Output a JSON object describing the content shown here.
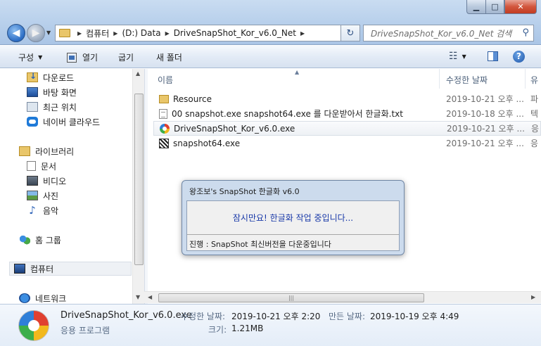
{
  "window": {
    "controls": {
      "minimize": "▁",
      "maximize": "□",
      "close": "✕"
    }
  },
  "address": {
    "segments": [
      "컴퓨터",
      "(D:) Data",
      "DriveSnapShot_Kor_v6.0_Net"
    ],
    "search_placeholder": "DriveSnapShot_Kor_v6.0_Net 검색"
  },
  "toolbar": {
    "organize": "구성",
    "open": "열기",
    "share": "굽기",
    "new_folder": "새 폴더"
  },
  "sidebar": {
    "favorites": [
      {
        "label": "다운로드",
        "icon": "download-folder-icon"
      },
      {
        "label": "바탕 화면",
        "icon": "desktop-icon"
      },
      {
        "label": "최근 위치",
        "icon": "recent-places-icon"
      },
      {
        "label": "네이버 클라우드",
        "icon": "naver-cloud-icon"
      }
    ],
    "libraries": {
      "label": "라이브러리",
      "items": [
        {
          "label": "문서",
          "icon": "documents-icon"
        },
        {
          "label": "비디오",
          "icon": "videos-icon"
        },
        {
          "label": "사진",
          "icon": "pictures-icon"
        },
        {
          "label": "음악",
          "icon": "music-icon"
        }
      ]
    },
    "homegroup": "홈 그룹",
    "computer": "컴퓨터",
    "network": "네트워크"
  },
  "columns": {
    "name": "이름",
    "date_modified": "수정한 날짜",
    "type": "유"
  },
  "files": [
    {
      "name": "Resource",
      "date": "2019-10-21 오후 ...",
      "type": "파",
      "icon": "folder-icon"
    },
    {
      "name": "00 snapshot.exe snapshot64.exe 를 다운받아서 한글화.txt",
      "date": "2019-10-18 오후 ...",
      "type": "텍",
      "icon": "text-file-icon"
    },
    {
      "name": "DriveSnapShot_Kor_v6.0.exe",
      "date": "2019-10-21 오후 ...",
      "type": "응",
      "icon": "app-icon"
    },
    {
      "name": "snapshot64.exe",
      "date": "2019-10-21 오후 ...",
      "type": "응",
      "icon": "exe-icon"
    }
  ],
  "details": {
    "name": "DriveSnapShot_Kor_v6.0.exe",
    "type": "응용 프로그램",
    "modified_label": "수정한 날짜:",
    "modified_value": "2019-10-21 오후 2:20",
    "created_label": "만든 날짜:",
    "created_value": "2019-10-19 오후 4:49",
    "size_label": "크기:",
    "size_value": "1.21MB"
  },
  "dialog": {
    "title": "왕조보's SnapShot 한글화 v6.0",
    "message": "잠시만요! 한글화 작업 중입니다...",
    "status": "진행 :  SnapShot 최신버전을 다운중입니다"
  }
}
